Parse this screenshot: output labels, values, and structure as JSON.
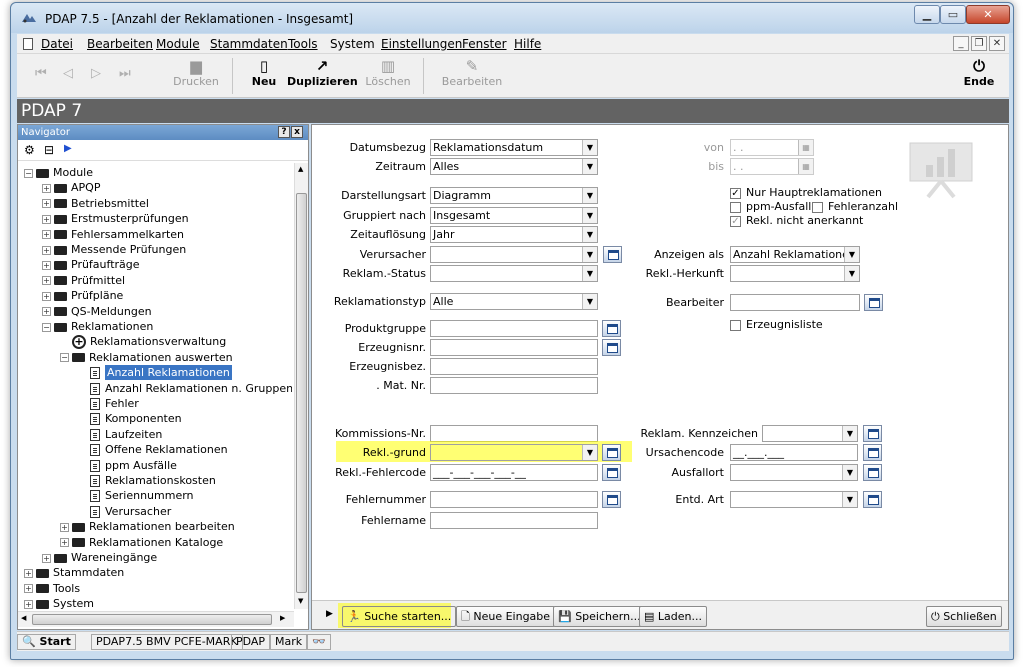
{
  "window": {
    "title": "PDAP 7.5 - [Anzahl der Reklamationen - Insgesamt]"
  },
  "menu": {
    "items": [
      {
        "label": "Datei"
      },
      {
        "label": "Bearbeiten"
      },
      {
        "label": "Module"
      },
      {
        "label": "Stammdaten"
      },
      {
        "label": "Tools"
      },
      {
        "label": "System"
      },
      {
        "label": "Einstellungen"
      },
      {
        "label": "Fenster"
      },
      {
        "label": "Hilfe"
      }
    ]
  },
  "toolbar": {
    "print": "Drucken",
    "new": "Neu",
    "duplicate": "Duplizieren",
    "delete": "Löschen",
    "edit": "Bearbeiten",
    "end": "Ende"
  },
  "banner": "PDAP 7",
  "navigator": {
    "title": "Navigator",
    "help": "?",
    "close": "x",
    "tree": [
      {
        "label": "Module",
        "level": 0,
        "type": "folder-open",
        "expander": "−"
      },
      {
        "label": "APQP",
        "level": 1,
        "type": "folder",
        "expander": "+"
      },
      {
        "label": "Betriebsmittel",
        "level": 1,
        "type": "folder",
        "expander": "+"
      },
      {
        "label": "Erstmusterprüfungen",
        "level": 1,
        "type": "folder",
        "expander": "+"
      },
      {
        "label": "Fehlersammelkarten",
        "level": 1,
        "type": "folder",
        "expander": "+"
      },
      {
        "label": "Messende Prüfungen",
        "level": 1,
        "type": "folder",
        "expander": "+"
      },
      {
        "label": "Prüfaufträge",
        "level": 1,
        "type": "folder",
        "expander": "+"
      },
      {
        "label": "Prüfmittel",
        "level": 1,
        "type": "folder",
        "expander": "+"
      },
      {
        "label": "Prüfpläne",
        "level": 1,
        "type": "folder",
        "expander": "+"
      },
      {
        "label": "QS-Meldungen",
        "level": 1,
        "type": "folder",
        "expander": "+"
      },
      {
        "label": "Reklamationen",
        "level": 1,
        "type": "folder-open",
        "expander": "−"
      },
      {
        "label": "Reklamationsverwaltung",
        "level": 2,
        "type": "plus-circle",
        "expander": ""
      },
      {
        "label": "Reklamationen auswerten",
        "level": 2,
        "type": "folder-open",
        "expander": "−"
      },
      {
        "label": "Anzahl Reklamationen",
        "level": 3,
        "type": "doc",
        "expander": "",
        "selected": true
      },
      {
        "label": "Anzahl Reklamationen n. Gruppen",
        "level": 3,
        "type": "doc",
        "expander": ""
      },
      {
        "label": "Fehler",
        "level": 3,
        "type": "doc",
        "expander": ""
      },
      {
        "label": "Komponenten",
        "level": 3,
        "type": "doc",
        "expander": ""
      },
      {
        "label": "Laufzeiten",
        "level": 3,
        "type": "doc",
        "expander": ""
      },
      {
        "label": "Offene Reklamationen",
        "level": 3,
        "type": "doc",
        "expander": ""
      },
      {
        "label": "ppm Ausfälle",
        "level": 3,
        "type": "doc",
        "expander": ""
      },
      {
        "label": "Reklamationskosten",
        "level": 3,
        "type": "doc",
        "expander": ""
      },
      {
        "label": "Seriennummern",
        "level": 3,
        "type": "doc",
        "expander": ""
      },
      {
        "label": "Verursacher",
        "level": 3,
        "type": "doc",
        "expander": ""
      },
      {
        "label": "Reklamationen bearbeiten",
        "level": 2,
        "type": "folder",
        "expander": "+"
      },
      {
        "label": "Reklamationen Kataloge",
        "level": 2,
        "type": "folder",
        "expander": "+"
      },
      {
        "label": "Wareneingänge",
        "level": 1,
        "type": "folder",
        "expander": "+"
      },
      {
        "label": "Stammdaten",
        "level": 0,
        "type": "folder",
        "expander": "+"
      },
      {
        "label": "Tools",
        "level": 0,
        "type": "folder",
        "expander": "+"
      },
      {
        "label": "System",
        "level": 0,
        "type": "folder",
        "expander": "+"
      }
    ]
  },
  "form": {
    "datumsbezug": {
      "label": "Datumsbezug",
      "value": "Reklamationsdatum"
    },
    "zeitraum": {
      "label": "Zeitraum",
      "value": "Alles"
    },
    "von": {
      "label": "von",
      "value": " .  ."
    },
    "bis": {
      "label": "bis",
      "value": " .  ."
    },
    "darstellungsart": {
      "label": "Darstellungsart",
      "value": "Diagramm"
    },
    "gruppiert": {
      "label": "Gruppiert nach",
      "value": "Insgesamt"
    },
    "zeitaufloesung": {
      "label": "Zeitauflösung",
      "value": "Jahr"
    },
    "verursacher": {
      "label": "Verursacher",
      "value": ""
    },
    "reklam_status": {
      "label": "Reklam.-Status",
      "value": ""
    },
    "reklamationstyp": {
      "label": "Reklamationstyp",
      "value": "Alle"
    },
    "produktgruppe": {
      "label": "Produktgruppe",
      "value": ""
    },
    "erzeugnisnr": {
      "label": "Erzeugnisnr.",
      "value": ""
    },
    "erzeugnisbez": {
      "label": "Erzeugnisbez.",
      "value": ""
    },
    "mat_nr": {
      "label": ". Mat. Nr.",
      "value": ""
    },
    "kommissions_nr": {
      "label": "Kommissions-Nr.",
      "value": ""
    },
    "rekl_grund": {
      "label": "Rekl.-grund",
      "value": ""
    },
    "rekl_fehlercode": {
      "label": "Rekl.-Fehlercode",
      "value": "___-___-___-___-__"
    },
    "fehlernummer": {
      "label": "Fehlernummer",
      "value": ""
    },
    "fehlername": {
      "label": "Fehlername",
      "value": ""
    },
    "nur_haupt": {
      "label": "Nur Hauptreklamationen",
      "checked": true
    },
    "ppm_ausfall": {
      "label": "ppm-Ausfall",
      "checked": false
    },
    "fehleranzahl": {
      "label": "Fehleranzahl",
      "checked": false
    },
    "nicht_anerkannt": {
      "label": "Rekl. nicht anerkannt",
      "checked": true
    },
    "anzeigen_als": {
      "label": "Anzeigen als",
      "value": "Anzahl Reklamationen"
    },
    "rekl_herkunft": {
      "label": "Rekl.-Herkunft",
      "value": ""
    },
    "bearbeiter": {
      "label": "Bearbeiter",
      "value": ""
    },
    "erzeugnisliste": {
      "label": "Erzeugnisliste",
      "checked": false
    },
    "reklam_kennzeichen": {
      "label": "Reklam. Kennzeichen",
      "value": ""
    },
    "ursachencode": {
      "label": "Ursachencode",
      "value": "__.___.___"
    },
    "ausfallort": {
      "label": "Ausfallort",
      "value": ""
    },
    "entd_art": {
      "label": "Entd. Art",
      "value": ""
    }
  },
  "bottom": {
    "search": "Suche starten...",
    "new_entry": "Neue Eingabe",
    "save": "Speichern...",
    "load": "Laden...",
    "close": "Schließen"
  },
  "status": {
    "start": "Start",
    "user": "PDAP7.5 BMV PCFE-MARK",
    "db": "PDAP",
    "mark": "Mark"
  }
}
